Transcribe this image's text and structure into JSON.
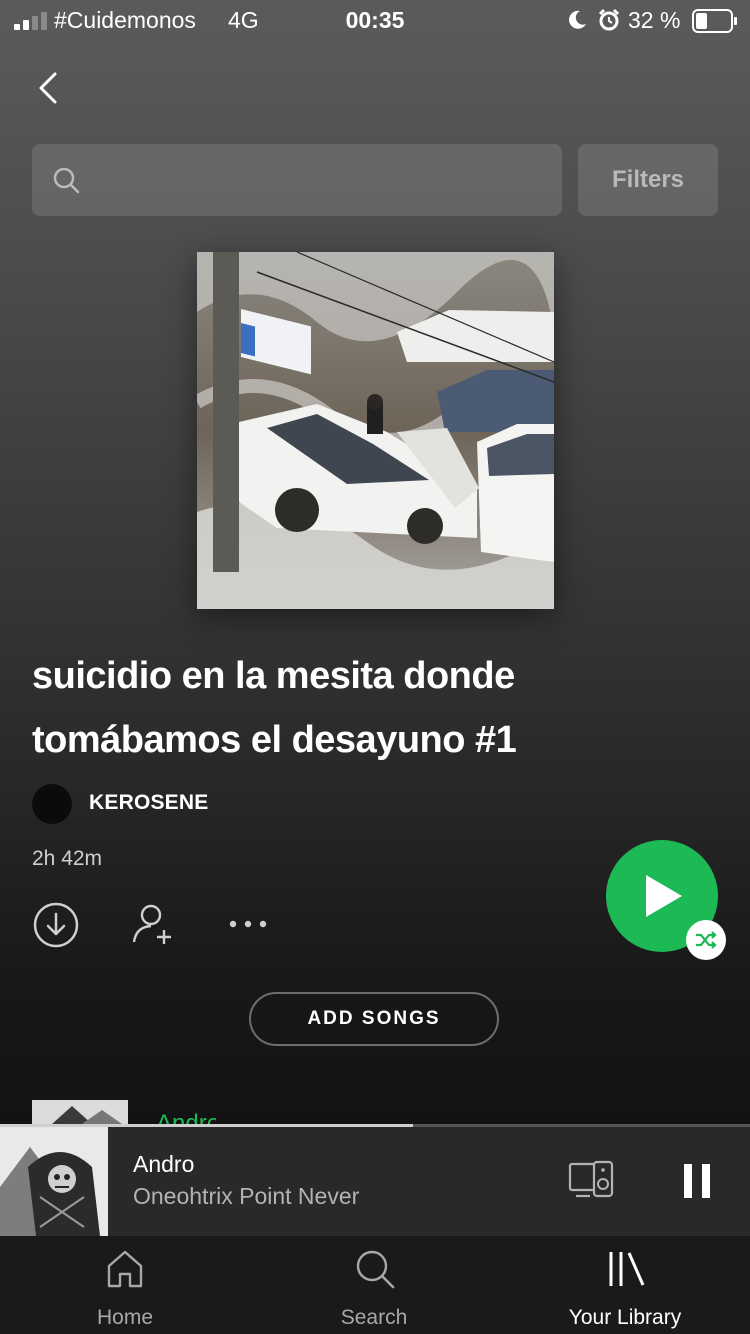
{
  "status_bar": {
    "carrier": "#Cuidemonos",
    "network": "4G",
    "time": "00:35",
    "battery": "32 %"
  },
  "header": {
    "back_icon": "chevron-left-icon",
    "search": {
      "placeholder": "",
      "icon": "search-icon"
    },
    "filters_label": "Filters"
  },
  "playlist": {
    "title_line1": "suicidio en la mesita donde",
    "title_line2": "tomábamos el desayuno #1",
    "owner": "KEROSENE",
    "duration": "2h 42m",
    "add_songs_label": "ADD SONGS",
    "accent": "#1db954"
  },
  "actions": {
    "download_icon": "download-icon",
    "add_user_icon": "add-user-icon",
    "more_icon": "more-icon",
    "play_icon": "play-icon",
    "shuffle_icon": "shuffle-icon"
  },
  "now_playing": {
    "track": "Andro",
    "artist": "Oneohtrix Point Never",
    "progress": 0.55,
    "devices_icon": "devices-icon",
    "pause_icon": "pause-icon"
  },
  "tabs": [
    {
      "label": "Home",
      "icon": "home-icon",
      "active": false
    },
    {
      "label": "Search",
      "icon": "search-icon",
      "active": false
    },
    {
      "label": "Your Library",
      "icon": "library-icon",
      "active": true
    }
  ]
}
